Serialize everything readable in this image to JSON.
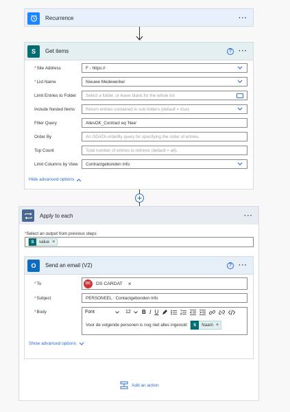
{
  "recurrence": {
    "title": "Recurrence",
    "menu": "···"
  },
  "get_items": {
    "title": "Get items",
    "help": "?",
    "menu": "···",
    "fields": [
      {
        "label": "Site Address",
        "required": true,
        "value": "F            - https://·",
        "placeholder": false
      },
      {
        "label": "List Name",
        "required": true,
        "value": "Nieuwe Medewerker",
        "placeholder": false
      },
      {
        "label": "Limit Entries to Folder",
        "required": false,
        "value": "Select a folder, or leave blank for the whole list",
        "placeholder": true
      },
      {
        "label": "Include Nested Items",
        "required": false,
        "value": "Return entries contained in sub-folders (default = true)",
        "placeholder": true
      },
      {
        "label": "Filter Query",
        "required": false,
        "value": "AllesOK_Contract eq 'Nee'",
        "placeholder": false
      },
      {
        "label": "Order By",
        "required": false,
        "value": "An ODATA orderBy query for specifying the order of entries.",
        "placeholder": true
      },
      {
        "label": "Top Count",
        "required": false,
        "value": "Total number of entries to retrieve (default = all).",
        "placeholder": true
      },
      {
        "label": "Limit Columns by View",
        "required": false,
        "value": "Contractgebonden Info",
        "placeholder": false
      }
    ],
    "advanced_link": "Hide advanced options"
  },
  "apply_each": {
    "title": "Apply to each",
    "menu": "···",
    "select_label": "Select an output from previous steps",
    "token": "value"
  },
  "send_email": {
    "title": "Send an email (V2)",
    "help": "?",
    "menu": "···",
    "to_label": "To",
    "to_initials": "DC",
    "to_value": "DS CARDAT",
    "subject_label": "Subject",
    "subject_value": "PERSONEEL : Contactgebonden Info",
    "body_label": "Body",
    "font_label": "Font",
    "font_size": "12",
    "body_text": "Voor de volgende personen is nog niet alles ingevuld:",
    "body_token": "Naam",
    "advanced_link": "Show advanced options"
  },
  "add_action": "Add an action",
  "colors": {
    "accent": "#2b6cd1",
    "sharepoint": "#036c70",
    "outlook": "#0f6cbd",
    "loop": "#486991"
  }
}
